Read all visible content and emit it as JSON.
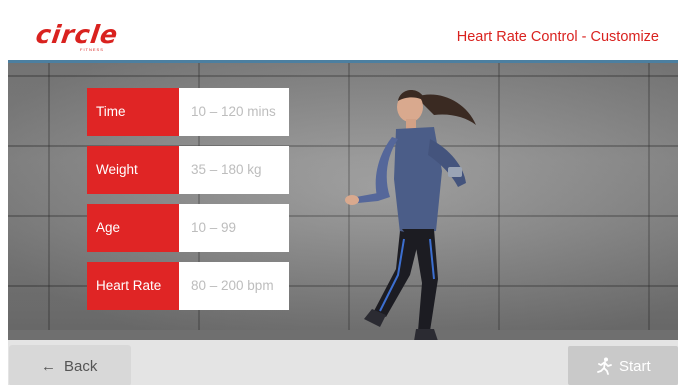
{
  "header": {
    "logo_text": "circle",
    "logo_subtext": "FITNESS",
    "title": "Heart Rate Control - Customize"
  },
  "params": [
    {
      "label": "Time",
      "range": "10 – 120 mins"
    },
    {
      "label": "Weight",
      "range": "35 – 180 kg"
    },
    {
      "label": "Age",
      "range": "10 – 99"
    },
    {
      "label": "Heart Rate",
      "range": "80 – 200 bpm"
    }
  ],
  "footer": {
    "back_label": "Back",
    "back_icon": "arrow-left-icon",
    "start_label": "Start",
    "start_icon": "runner-icon"
  },
  "colors": {
    "accent": "#e02525",
    "header_line": "#4c7fa0",
    "start_button_disabled": "#c9c9c9"
  }
}
